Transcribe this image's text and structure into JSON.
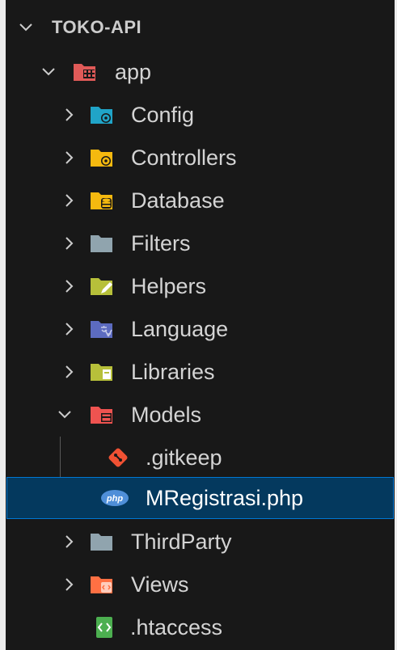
{
  "explorer": {
    "project_title": "TOKO-API",
    "tree": [
      {
        "label": "app",
        "icon": "app-folder-icon",
        "expanded": true
      },
      {
        "label": "Config",
        "icon": "config-folder-icon",
        "expanded": false
      },
      {
        "label": "Controllers",
        "icon": "controllers-folder-icon",
        "expanded": false
      },
      {
        "label": "Database",
        "icon": "database-folder-icon",
        "expanded": false
      },
      {
        "label": "Filters",
        "icon": "folder-icon",
        "expanded": false
      },
      {
        "label": "Helpers",
        "icon": "helpers-folder-icon",
        "expanded": false
      },
      {
        "label": "Language",
        "icon": "language-folder-icon",
        "expanded": false
      },
      {
        "label": "Libraries",
        "icon": "libraries-folder-icon",
        "expanded": false
      },
      {
        "label": "Models",
        "icon": "models-folder-icon",
        "expanded": true
      },
      {
        "label": ".gitkeep",
        "icon": "git-file-icon"
      },
      {
        "label": "MRegistrasi.php",
        "icon": "php-file-icon",
        "selected": true
      },
      {
        "label": "ThirdParty",
        "icon": "folder-icon",
        "expanded": false
      },
      {
        "label": "Views",
        "icon": "views-folder-icon",
        "expanded": false
      },
      {
        "label": ".htaccess",
        "icon": "htaccess-file-icon"
      }
    ]
  },
  "colors": {
    "background": "#181818",
    "selection": "#04395e",
    "selection_border": "#0078d4",
    "text": "#d4d4d4"
  }
}
